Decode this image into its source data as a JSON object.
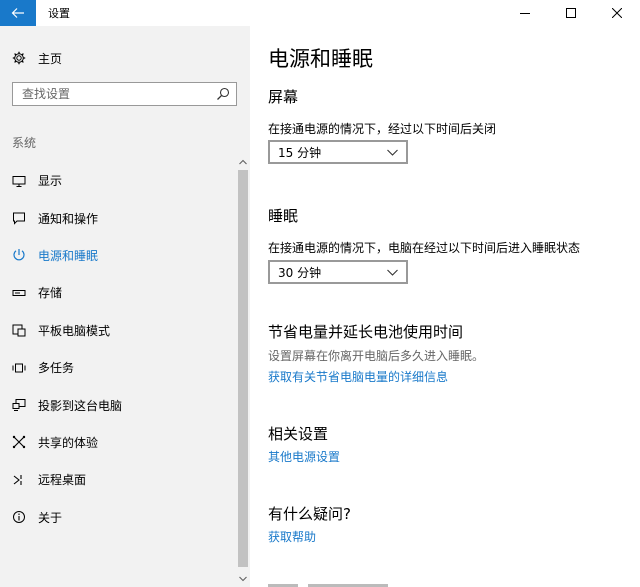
{
  "window": {
    "title": "设置"
  },
  "sidebar": {
    "home_label": "主页",
    "search_placeholder": "查找设置",
    "section_label": "系统",
    "items": [
      {
        "label": "显示",
        "icon": "monitor-icon"
      },
      {
        "label": "通知和操作",
        "icon": "notification-icon"
      },
      {
        "label": "电源和睡眠",
        "icon": "power-icon",
        "active": true
      },
      {
        "label": "存储",
        "icon": "storage-icon"
      },
      {
        "label": "平板电脑模式",
        "icon": "tablet-mode-icon"
      },
      {
        "label": "多任务",
        "icon": "multitasking-icon"
      },
      {
        "label": "投影到这台电脑",
        "icon": "project-icon"
      },
      {
        "label": "共享的体验",
        "icon": "shared-experience-icon"
      },
      {
        "label": "远程桌面",
        "icon": "remote-desktop-icon"
      },
      {
        "label": "关于",
        "icon": "info-icon"
      }
    ]
  },
  "main": {
    "title": "电源和睡眠",
    "screen": {
      "heading": "屏幕",
      "description": "在接通电源的情况下，经过以下时间后关闭",
      "value": "15 分钟"
    },
    "sleep": {
      "heading": "睡眠",
      "description": "在接通电源的情况下，电脑在经过以下时间后进入睡眠状态",
      "value": "30 分钟"
    },
    "battery": {
      "heading": "节省电量并延长电池使用时间",
      "description": "设置屏幕在你离开电脑后多久进入睡眠。",
      "link": "获取有关节省电脑电量的详细信息"
    },
    "related": {
      "heading": "相关设置",
      "link": "其他电源设置"
    },
    "question": {
      "heading": "有什么疑问?",
      "link": "获取帮助"
    }
  },
  "colors": {
    "accent": "#1979ca",
    "sidebar_bg": "#f2f2f2"
  }
}
